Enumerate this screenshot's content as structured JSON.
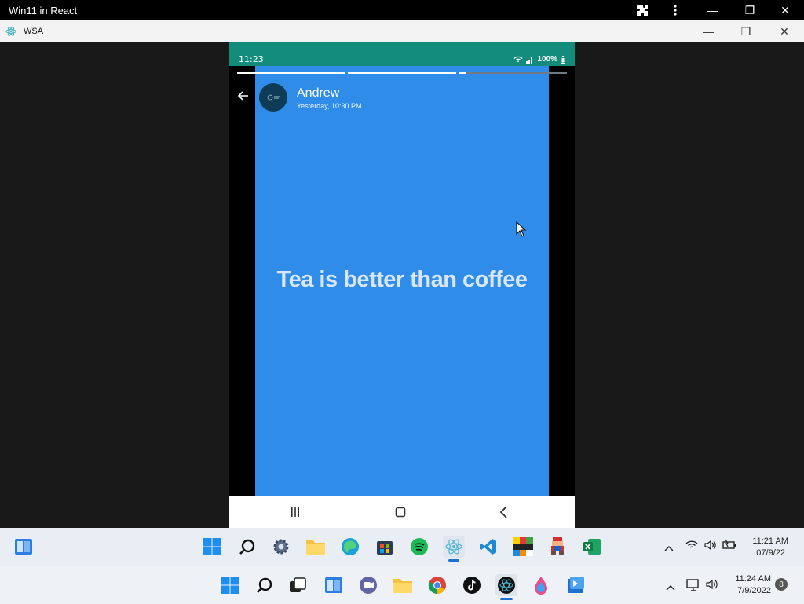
{
  "chrome": {
    "title": "Win11 in React",
    "min": "—",
    "restore": "❐",
    "close": "✕"
  },
  "wsa": {
    "title": "WSA",
    "min": "—",
    "restore": "❐",
    "close": "✕"
  },
  "phone": {
    "status": {
      "time": "11:23",
      "battery": "100%"
    },
    "story": {
      "contact_name": "Andrew",
      "timestamp": "Yesterday, 10:30 PM",
      "text": "Tea is better than coffee"
    },
    "nav": {
      "recent": "|||",
      "home": "□",
      "back": "<"
    }
  },
  "taskbar_inner": {
    "clock_time": "11:21 AM",
    "clock_date": "07/9/22",
    "tray_caret": "^"
  },
  "taskbar_outer": {
    "clock_time": "11:24 AM",
    "clock_date": "7/9/2022",
    "notification_count": "8",
    "tray_caret": "^"
  },
  "colors": {
    "status_bar": "#138c7b",
    "story_bg": "#2f8ce8",
    "chrome_bar": "#000000"
  }
}
